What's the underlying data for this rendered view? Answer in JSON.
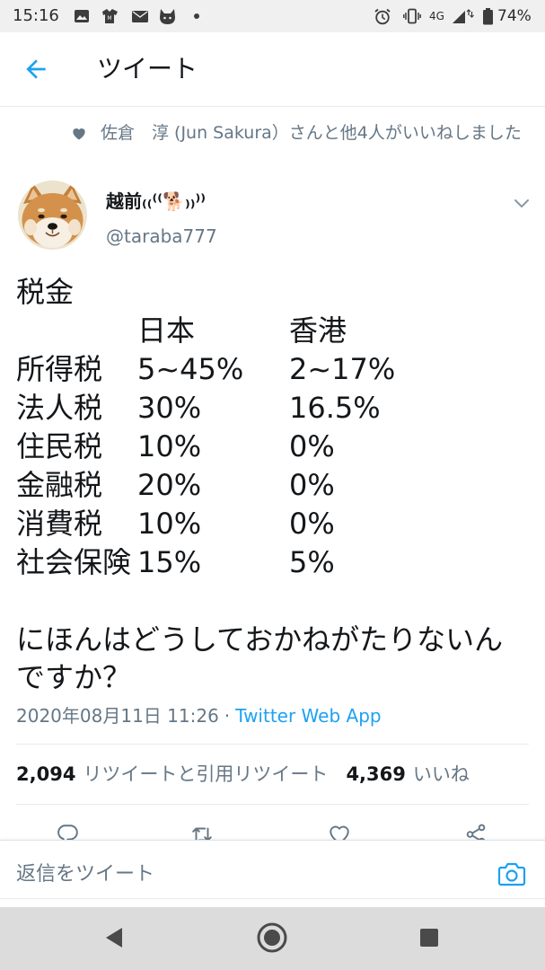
{
  "status_bar": {
    "time": "15:16",
    "notification_icons": [
      "image-icon",
      "app-icon",
      "mail-icon",
      "cat-icon",
      "dot-icon"
    ],
    "system_icons": [
      "alarm-icon",
      "vibrate-icon",
      "signal-icon",
      "battery-icon"
    ],
    "network": "4G",
    "battery": "74%"
  },
  "header": {
    "back_icon": "back-arrow-icon",
    "title": "ツイート"
  },
  "social_context": {
    "icon": "heart-icon",
    "text": "佐倉　淳 (Jun Sakura）さんと他4人がいいねしました"
  },
  "tweet": {
    "author": {
      "name": "越前₍₍⁽⁽🐕₎₎⁾⁾",
      "handle": "@taraba777"
    },
    "menu_icon": "chevron-down-icon",
    "intro": "税金",
    "table": {
      "columns": [
        "日本",
        "香港"
      ],
      "rows": [
        {
          "label": "所得税",
          "japan": "5~45%",
          "hong_kong": "2~17%"
        },
        {
          "label": "法人税",
          "japan": "30%",
          "hong_kong": "16.5%"
        },
        {
          "label": "住民税",
          "japan": "10%",
          "hong_kong": "0%"
        },
        {
          "label": "金融税",
          "japan": "20%",
          "hong_kong": "0%"
        },
        {
          "label": "消費税",
          "japan": "10%",
          "hong_kong": "0%"
        },
        {
          "label": "社会保険",
          "japan": "15%",
          "hong_kong": "5%"
        }
      ]
    },
    "question": "にほんはどうしておかねがたりないんですか？",
    "timestamp": "2020年08月11日 11:26",
    "separator": "·",
    "source": "Twitter Web App"
  },
  "stats": {
    "retweets_count": "2,094",
    "retweets_label": "リツイートと引用リツイート",
    "likes_count": "4,369",
    "likes_label": "いいね"
  },
  "actions": [
    "reply-icon",
    "retweet-icon",
    "like-icon",
    "share-icon"
  ],
  "reply_bar": {
    "placeholder": "返信をツイート",
    "icon": "camera-icon"
  },
  "nav_bar": {
    "icons": [
      "nav-back-icon",
      "nav-home-icon",
      "nav-recents-icon"
    ]
  },
  "colors": {
    "accent": "#1da1f2",
    "text": "#14171a",
    "secondary_text": "#657786",
    "divider": "#e6ecf0",
    "nav_bar": "#dcdcdc"
  }
}
